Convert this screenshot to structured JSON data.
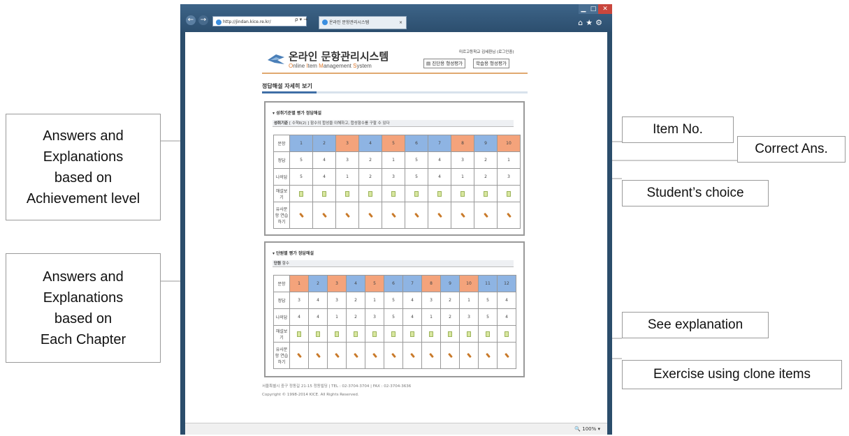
{
  "callouts": {
    "left_top": "Answers and\nExplanations\nbased on\nAchievement level",
    "left_bottom": "Answers and\nExplanations\nbased on\nEach Chapter",
    "item_no": "Item No.",
    "correct_ans": "Correct Ans.",
    "student_choice": "Student’s choice",
    "see_explanation": "See explanation",
    "exercise_clone": "Exercise using clone items"
  },
  "browser": {
    "address": "http://jindan.kice.re.kr/",
    "address_tools": "ρ ▾ →",
    "tab_title": "온라인 문항관리시스템",
    "tab_close": "×",
    "win_min": "▁",
    "win_max": "□",
    "win_close": "✕",
    "right_tools": "⌂★⚙",
    "zoom": "100%",
    "zoom_icon": "🔍",
    "colors": {
      "frame": "#2b4d6b",
      "close": "#c9463d"
    }
  },
  "site": {
    "title": "온라인 문항관리시스템",
    "subtitle_parts": [
      "O",
      "nline ",
      "I",
      "tem ",
      "M",
      "anagement ",
      "S",
      "ystem"
    ],
    "user": "미르고등학교 김세환님 (로그인중)",
    "btn_diagnostic": "진단용 형성평가",
    "btn_learning": "학습용 형성평가",
    "page_title": "정답해설 자세히 보기"
  },
  "panel1": {
    "title": "성취기준별 평가 정답해설",
    "bar_label": "성취기준",
    "bar_text": "[ 수학Ⅱ(2) ] 함수의 합성을 이해하고, 합성함수를 구할 수 있다",
    "row_labels": [
      "문항",
      "정답",
      "나의답",
      "해설보기",
      "유사문항 연습하기"
    ],
    "items": [
      "1",
      "2",
      "3",
      "4",
      "5",
      "6",
      "7",
      "8",
      "9",
      "10"
    ],
    "item_colors": [
      "blue",
      "blue",
      "orange",
      "blue",
      "orange",
      "blue",
      "blue",
      "orange",
      "blue",
      "orange"
    ],
    "correct": [
      "5",
      "4",
      "3",
      "2",
      "1",
      "5",
      "4",
      "3",
      "2",
      "1"
    ],
    "mine": [
      "5",
      "4",
      "1",
      "2",
      "3",
      "5",
      "4",
      "1",
      "2",
      "3"
    ]
  },
  "panel2": {
    "title": "단원별 평가 정답해설",
    "bar_label": "단원",
    "bar_text": "함수",
    "row_labels": [
      "문항",
      "정답",
      "나의답",
      "해설보기",
      "유사문항 연습하기"
    ],
    "items": [
      "1",
      "2",
      "3",
      "4",
      "5",
      "6",
      "7",
      "8",
      "9",
      "10",
      "11",
      "12"
    ],
    "item_colors": [
      "orange",
      "blue",
      "orange",
      "blue",
      "orange",
      "blue",
      "blue",
      "orange",
      "blue",
      "orange",
      "blue",
      "blue"
    ],
    "correct": [
      "3",
      "4",
      "3",
      "2",
      "1",
      "5",
      "4",
      "3",
      "2",
      "1",
      "5",
      "4"
    ],
    "mine": [
      "4",
      "4",
      "1",
      "2",
      "3",
      "5",
      "4",
      "1",
      "2",
      "3",
      "5",
      "4"
    ]
  },
  "footer": {
    "line1": "서울특별시 중구 정동길 21-15 정동빌딩  |  TEL : 02-3704-3704  |  FAX : 02-3704-3636",
    "line2": "Copyright © 1998-2014 KICE. All Rights Reserved."
  }
}
